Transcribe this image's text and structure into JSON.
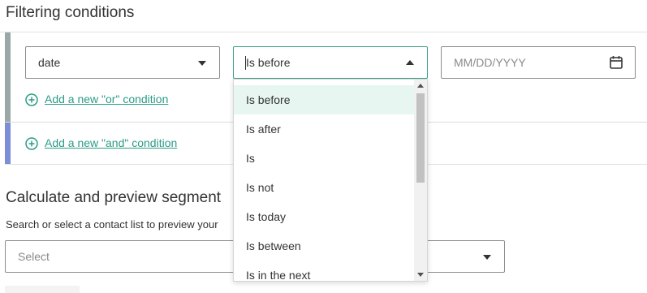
{
  "filtering": {
    "title": "Filtering conditions",
    "field_select_value": "date",
    "operator_select_value": "Is before",
    "date_placeholder": "MM/DD/YYYY",
    "add_or_label": "Add a new \"or\" condition",
    "add_and_label": "Add a new \"and\" condition",
    "accent_color": "#2c9c86",
    "or_bar_color": "#9aa7a7",
    "and_bar_color": "#7b8ed6"
  },
  "operator_dropdown": {
    "options": [
      "Is before",
      "Is after",
      "Is",
      "Is not",
      "Is today",
      "Is between",
      "Is in the next"
    ],
    "selected": "Is before"
  },
  "calculate": {
    "title": "Calculate and preview segment",
    "description": "Search or select a contact list to preview your",
    "select_placeholder": "Select"
  },
  "icons": {
    "calendar": "calendar-icon",
    "plus": "plus-circle-icon",
    "caret": "chevron-down-icon"
  }
}
